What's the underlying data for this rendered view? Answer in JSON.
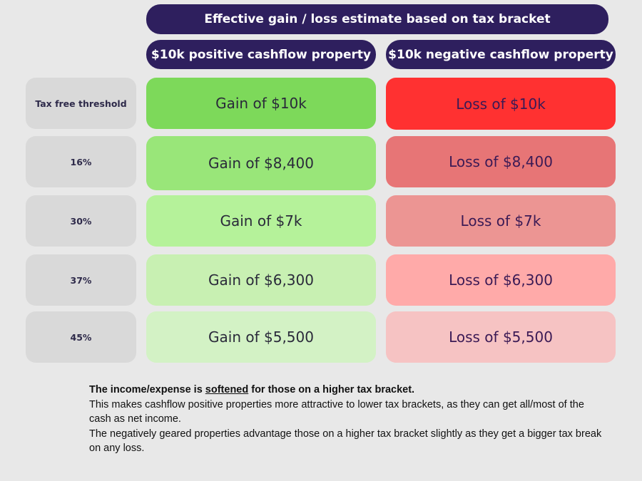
{
  "header": {
    "title": "Effective gain / loss estimate based on tax bracket",
    "columns": [
      {
        "label": "$10k positive cashflow property"
      },
      {
        "label": "$10k negative cashflow property"
      }
    ]
  },
  "rows": [
    {
      "bracket": "Tax free threshold",
      "gain": "Gain of $10k",
      "loss": "Loss of $10k",
      "gain_color": "#7dd95a",
      "loss_color": "#ff3131"
    },
    {
      "bracket": "16%",
      "gain": "Gain of $8,400",
      "loss": "Loss of $8,400",
      "gain_color": "#99e679",
      "loss_color": "#e77576"
    },
    {
      "bracket": "30%",
      "gain": "Gain of $7k",
      "loss": "Loss of $7k",
      "gain_color": "#b5f29a",
      "loss_color": "#ec9593"
    },
    {
      "bracket": "37%",
      "gain": "Gain of $6,300",
      "loss": "Loss of $6,300",
      "gain_color": "#c8f0b2",
      "loss_color": "#ffaaa9"
    },
    {
      "bracket": "45%",
      "gain": "Gain of $5,500",
      "loss": "Loss of $5,500",
      "gain_color": "#d3f2c5",
      "loss_color": "#f6c3c3"
    }
  ],
  "footer": {
    "lead_before": "The income/expense is ",
    "lead_underlined": "softened",
    "lead_after": " for those on a higher tax bracket.",
    "line1": "This makes cashflow positive properties more attractive to lower tax brackets, as they can get all/most of the cash as net income.",
    "line2": "The negatively geared properties advantage those on a higher tax bracket slightly as they get a bigger tax break on any loss."
  },
  "colors": {
    "pill_bg": "#2e1f5e",
    "label_bg": "#d9d9d9",
    "page_bg": "#e8e8e8"
  }
}
